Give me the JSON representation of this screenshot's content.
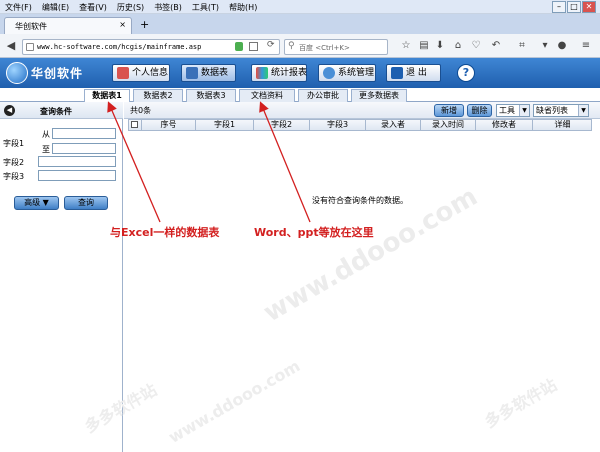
{
  "menubar": {
    "items": [
      "文件(F)",
      "编辑(E)",
      "查看(V)",
      "历史(S)",
      "书签(B)",
      "工具(T)",
      "帮助(H)"
    ]
  },
  "window_controls": {
    "minimize": "–",
    "maximize": "□",
    "close": "✕"
  },
  "browser_tab": {
    "title": "华创软件",
    "close": "×",
    "new_tab": "+"
  },
  "navbar": {
    "back": "◀",
    "url": "www.hc-software.com/hcgis/mainframe.asp",
    "search_placeholder": "百度 <Ctrl+K>"
  },
  "app": {
    "logo_text": "华创软件",
    "buttons": {
      "personal": "个人信息",
      "datasheet": "数据表",
      "reports": "统计报表",
      "system": "系统管理",
      "logout": "退 出",
      "help": "?"
    }
  },
  "sheet_tabs": [
    "数据表1",
    "数据表2",
    "数据表3",
    "文档资料",
    "办公审批",
    "更多数据表"
  ],
  "left_panel": {
    "title": "查询条件",
    "field1": "字段1",
    "from": "从",
    "to": "至",
    "field2": "字段2",
    "field3": "字段3",
    "advanced": "高级 ▼",
    "query": "查询"
  },
  "grid": {
    "count": "共0条",
    "add": "新增",
    "delete": "删除",
    "tools_select": "工具",
    "view_select": "缺省列表",
    "columns": [
      "序号",
      "字段1",
      "字段2",
      "字段3",
      "录入者",
      "录入时间",
      "修改者",
      "详细"
    ],
    "empty_message": "没有符合查询条件的数据。"
  },
  "annotations": {
    "excel": "与Excel一样的数据表",
    "word": "Word、ppt等放在这里"
  },
  "watermarks": [
    "多多软件站",
    "www.ddooo.com"
  ],
  "colors": {
    "header": "#2a6cbf",
    "annotation": "#d32020"
  }
}
